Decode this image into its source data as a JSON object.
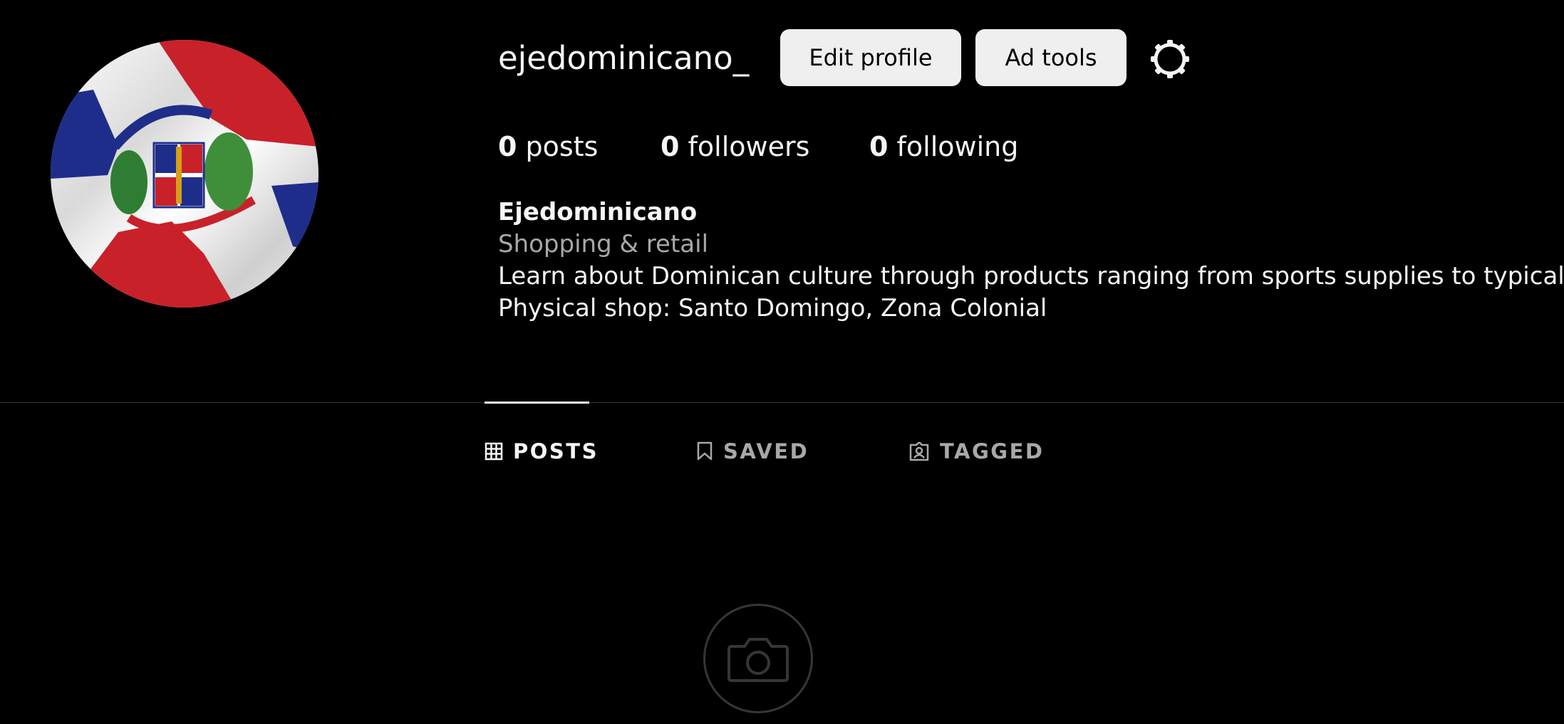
{
  "profile": {
    "username": "ejedominicano_",
    "avatar_icon": "dominican-flag-avatar",
    "edit_profile_label": "Edit profile",
    "ad_tools_label": "Ad tools",
    "settings_icon": "gear-icon"
  },
  "stats": {
    "posts_count": "0",
    "posts_label": " posts",
    "followers_count": "0",
    "followers_label": " followers",
    "following_count": "0",
    "following_label": " following"
  },
  "bio": {
    "name": "Ejedominicano",
    "category": "Shopping & retail",
    "line1": "Learn about Dominican culture through products ranging from sports supplies to typical food.",
    "line2": "Physical shop: Santo Domingo, Zona Colonial"
  },
  "tabs": [
    {
      "label": "POSTS",
      "icon": "grid-icon",
      "active": true
    },
    {
      "label": "SAVED",
      "icon": "bookmark-icon",
      "active": false
    },
    {
      "label": "TAGGED",
      "icon": "tagged-icon",
      "active": false
    }
  ],
  "empty_state": {
    "icon": "camera-icon"
  },
  "colors": {
    "background": "#000000",
    "text_primary": "#f5f5f5",
    "text_secondary": "#a8a8a8",
    "button_bg": "#efefef",
    "divider": "#363636",
    "flag_blue": "#1f2d8a",
    "flag_red": "#c8212a"
  }
}
